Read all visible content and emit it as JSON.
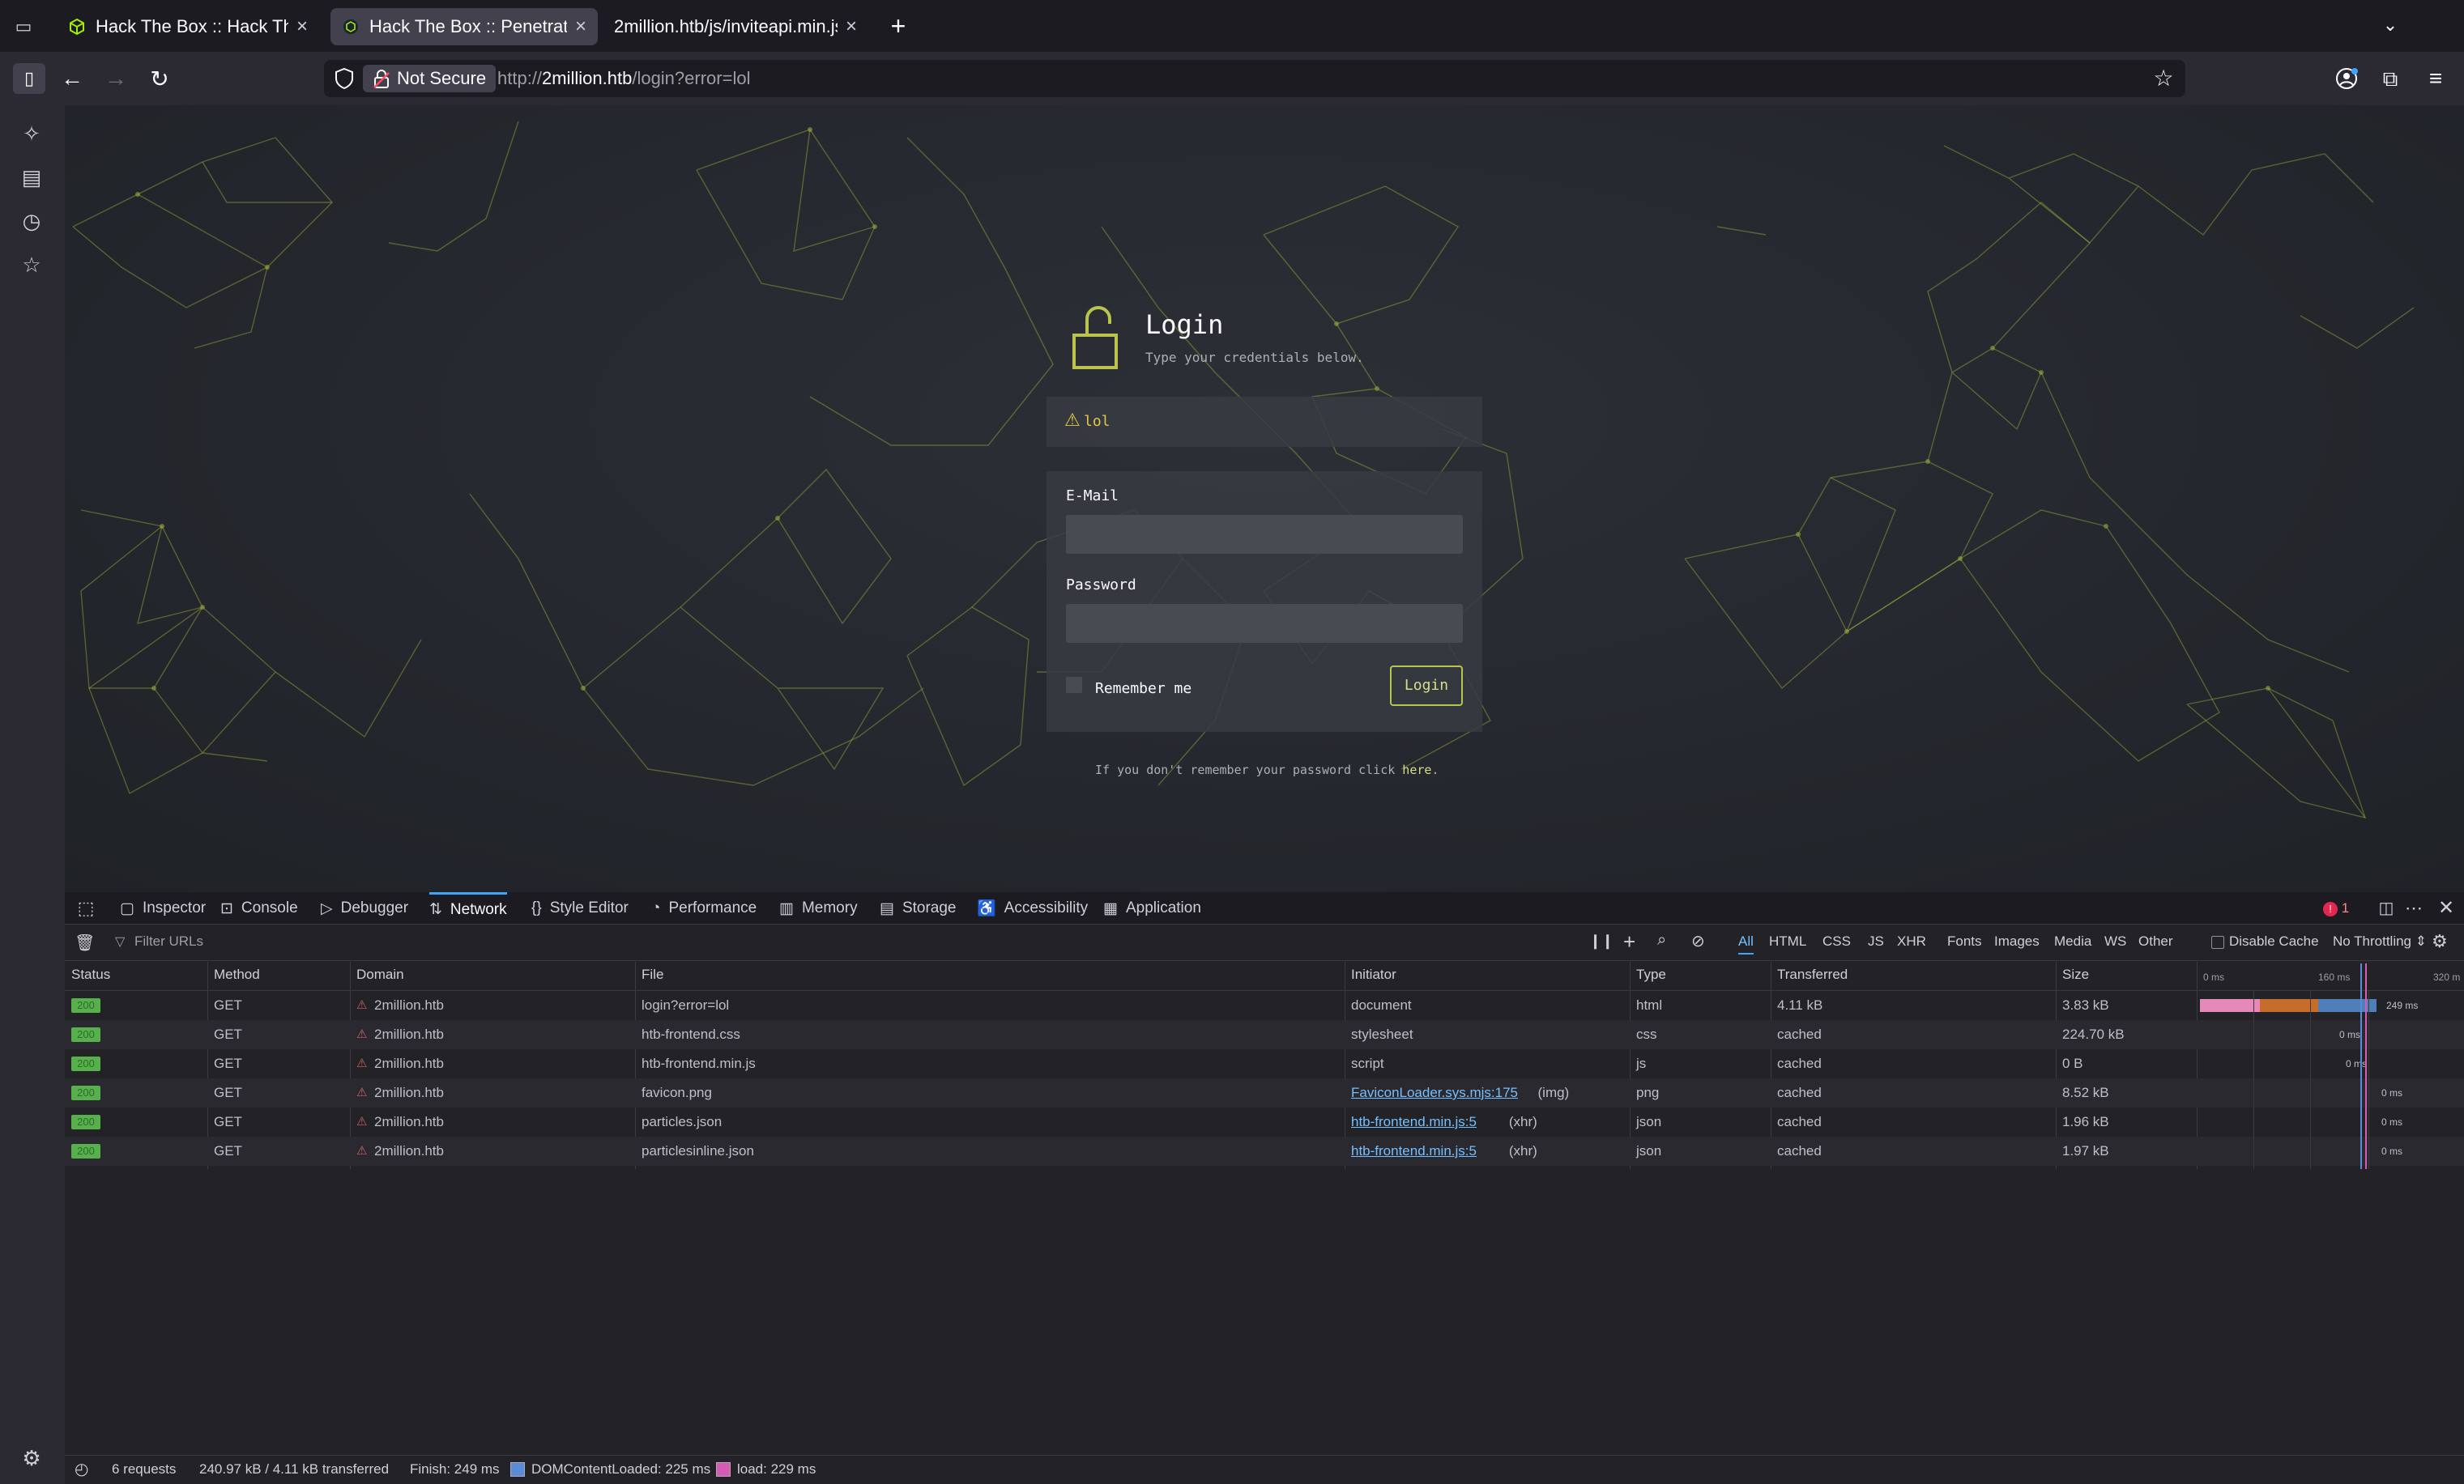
{
  "tabs": [
    {
      "title": "Hack The Box :: Hack The B",
      "active": false
    },
    {
      "title": "Hack The Box :: Penetration",
      "active": true
    },
    {
      "title": "2million.htb/js/inviteapi.min.js",
      "active": false
    }
  ],
  "nav": {
    "not_secure": "Not Secure",
    "url_prefix": "http://",
    "url_host": "2million.htb",
    "url_path": "/login?error=lol"
  },
  "login": {
    "title": "Login",
    "subtitle": "Type your credentials below.",
    "alert": "lol",
    "email_label": "E-Mail",
    "password_label": "Password",
    "remember_label": "Remember me",
    "login_button": "Login",
    "forgot_text": "If you don't remember your password click",
    "forgot_link": "here",
    "forgot_end": "."
  },
  "devtools": {
    "tabs": [
      "Inspector",
      "Console",
      "Debugger",
      "Network",
      "Style Editor",
      "Performance",
      "Memory",
      "Storage",
      "Accessibility",
      "Application"
    ],
    "selected_tab": "Network",
    "error_count": "1",
    "filter_placeholder": "Filter URLs",
    "type_filters": [
      "All",
      "HTML",
      "CSS",
      "JS",
      "XHR",
      "Fonts",
      "Images",
      "Media",
      "WS",
      "Other"
    ],
    "disable_cache": "Disable Cache",
    "throttling": "No Throttling",
    "columns": [
      "Status",
      "Method",
      "Domain",
      "File",
      "Initiator",
      "Type",
      "Transferred",
      "Size"
    ],
    "timeline_ticks": [
      "0 ms",
      "160 ms",
      "320 m"
    ],
    "requests": [
      {
        "status": "200",
        "method": "GET",
        "domain": "2million.htb",
        "file": "login?error=lol",
        "initiator": "document",
        "initiator_suffix": "",
        "initiator_link": false,
        "type": "html",
        "transferred": "4.11 kB",
        "size": "3.83 kB",
        "time": "249 ms"
      },
      {
        "status": "200",
        "method": "GET",
        "domain": "2million.htb",
        "file": "htb-frontend.css",
        "initiator": "stylesheet",
        "initiator_suffix": "",
        "initiator_link": false,
        "type": "css",
        "transferred": "cached",
        "size": "224.70 kB",
        "time": "0 ms"
      },
      {
        "status": "200",
        "method": "GET",
        "domain": "2million.htb",
        "file": "htb-frontend.min.js",
        "initiator": "script",
        "initiator_suffix": "",
        "initiator_link": false,
        "type": "js",
        "transferred": "cached",
        "size": "0 B",
        "time": "0 ms"
      },
      {
        "status": "200",
        "method": "GET",
        "domain": "2million.htb",
        "file": "favicon.png",
        "initiator": "FaviconLoader.sys.mjs:175",
        "initiator_suffix": "(img)",
        "initiator_link": true,
        "type": "png",
        "transferred": "cached",
        "size": "8.52 kB",
        "time": "0 ms"
      },
      {
        "status": "200",
        "method": "GET",
        "domain": "2million.htb",
        "file": "particles.json",
        "initiator": "htb-frontend.min.js:5",
        "initiator_suffix": "(xhr)",
        "initiator_link": true,
        "type": "json",
        "transferred": "cached",
        "size": "1.96 kB",
        "time": "0 ms"
      },
      {
        "status": "200",
        "method": "GET",
        "domain": "2million.htb",
        "file": "particlesinline.json",
        "initiator": "htb-frontend.min.js:5",
        "initiator_suffix": "(xhr)",
        "initiator_link": true,
        "type": "json",
        "transferred": "cached",
        "size": "1.97 kB",
        "time": "0 ms"
      }
    ],
    "summary": {
      "requests": "6 requests",
      "transferred": "240.97 kB / 4.11 kB transferred",
      "finish": "Finish: 249 ms",
      "dcl": "DOMContentLoaded: 225 ms",
      "load": "load: 229 ms"
    }
  },
  "colors": {
    "accent_green": "#9fef00",
    "htb_olive": "#b8c44d",
    "status_ok": "#58b04d",
    "link_blue": "#75bfff",
    "devtools_tab_accent": "#3da5ff"
  }
}
